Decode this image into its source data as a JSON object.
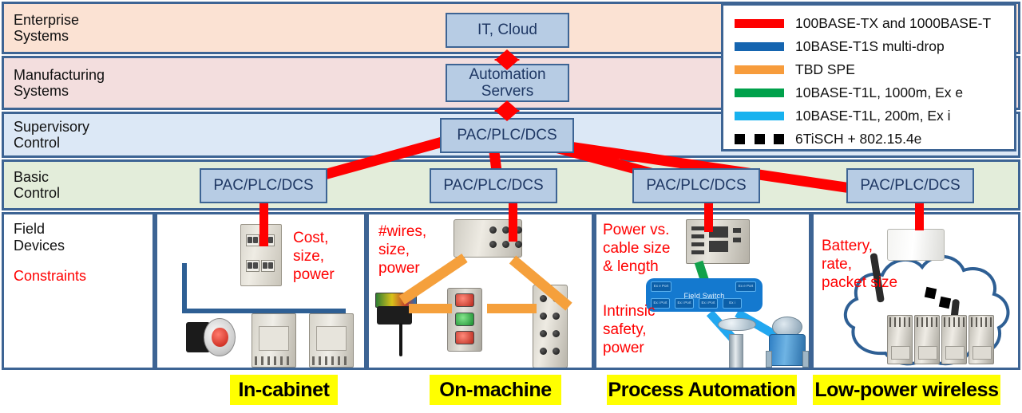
{
  "levels": [
    {
      "id": "enterprise",
      "label": "Enterprise\nSystems",
      "color": "#fbe2d3"
    },
    {
      "id": "manufacturing",
      "label": "Manufacturing\nSystems",
      "color": "#f3dede"
    },
    {
      "id": "supervisory",
      "label": "Supervisory\nControl",
      "color": "#dce8f6"
    },
    {
      "id": "basic",
      "label": "Basic\nControl",
      "color": "#e3edda"
    }
  ],
  "field_row": {
    "title": "Field\nDevices",
    "constraints_label": "Constraints"
  },
  "nodes": {
    "it_cloud": "IT, Cloud",
    "automation_servers": "Automation\nServers",
    "supervisory_pac": "PAC/PLC/DCS",
    "basic_pac_1": "PAC/PLC/DCS",
    "basic_pac_2": "PAC/PLC/DCS",
    "basic_pac_3": "PAC/PLC/DCS",
    "basic_pac_4": "PAC/PLC/DCS"
  },
  "constraints": {
    "cabinet": "Cost,\nsize,\npower",
    "machine": "#wires,\nsize,\npower",
    "process_top": "Power vs.\ncable size\n& length",
    "process_bottom": "Intrinsic\nsafety,\npower",
    "wireless": "Battery,\nrate,\npacket size"
  },
  "legend": {
    "items": [
      {
        "label": "100BASE-TX and 1000BASE-T",
        "color": "#fe0000",
        "style": "solid"
      },
      {
        "label": "10BASE-T1S multi-drop",
        "color": "#1565b0",
        "style": "solid"
      },
      {
        "label": "TBD SPE",
        "color": "#f79c3c",
        "style": "solid"
      },
      {
        "label": "10BASE-T1L, 1000m, Ex e",
        "color": "#00a14b",
        "style": "solid"
      },
      {
        "label": "10BASE-T1L, 200m, Ex i",
        "color": "#18b2ef",
        "style": "solid"
      },
      {
        "label": "6TiSCH + 802.15.4e",
        "color": "#000000",
        "style": "dots"
      }
    ]
  },
  "category_tags": [
    {
      "id": "in-cabinet",
      "label": "In-cabinet"
    },
    {
      "id": "on-machine",
      "label": "On-machine"
    },
    {
      "id": "process-automation",
      "label": "Process Automation"
    },
    {
      "id": "low-power-wireless",
      "label": "Low-power wireless"
    }
  ],
  "process_panel": {
    "field_switch_label": "Field Switch",
    "ports": [
      "Ex e\nPort",
      "Ex e\nPort",
      "Ex i\nPort",
      "Ex i\nPort",
      "Ex i\nPort",
      "Ex\ni"
    ]
  },
  "colors": {
    "band_border": "#3d6494",
    "node_fill": "#b7cce4",
    "node_border": "#3d6494",
    "node_text": "#1f3864",
    "constraint_text": "#ff0000",
    "tag_bg": "#ffff00",
    "red_link": "#ff0000",
    "blue_multidrop": "#2e5f94",
    "orange_spe": "#f5a03c",
    "green_exe": "#12a14b",
    "cyan_exi": "#22a7f0"
  }
}
